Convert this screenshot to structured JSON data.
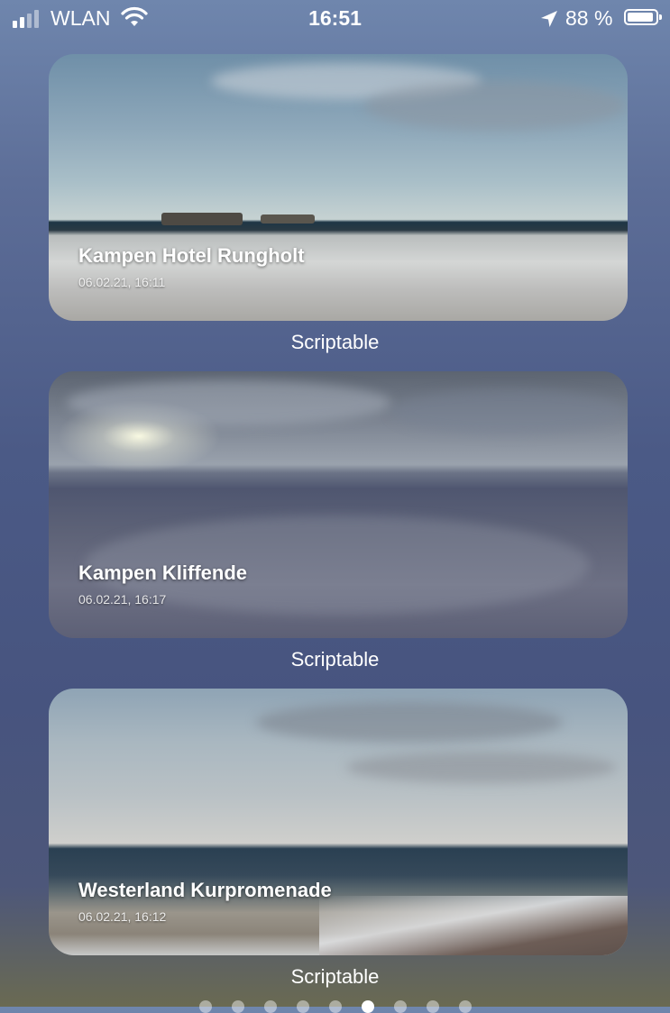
{
  "status_bar": {
    "carrier": "WLAN",
    "time": "16:51",
    "battery_percent": "88 %",
    "battery_level": 0.88
  },
  "widgets": [
    {
      "title": "Kampen Hotel Rungholt",
      "date": "06.02.21, 16:11",
      "app": "Scriptable"
    },
    {
      "title": "Kampen Kliffende",
      "date": "06.02.21, 16:17",
      "app": "Scriptable"
    },
    {
      "title": "Westerland Kurpromenade",
      "date": "06.02.21, 16:12",
      "app": "Scriptable"
    }
  ],
  "page_dots": {
    "count": 9,
    "active_index": 5
  }
}
